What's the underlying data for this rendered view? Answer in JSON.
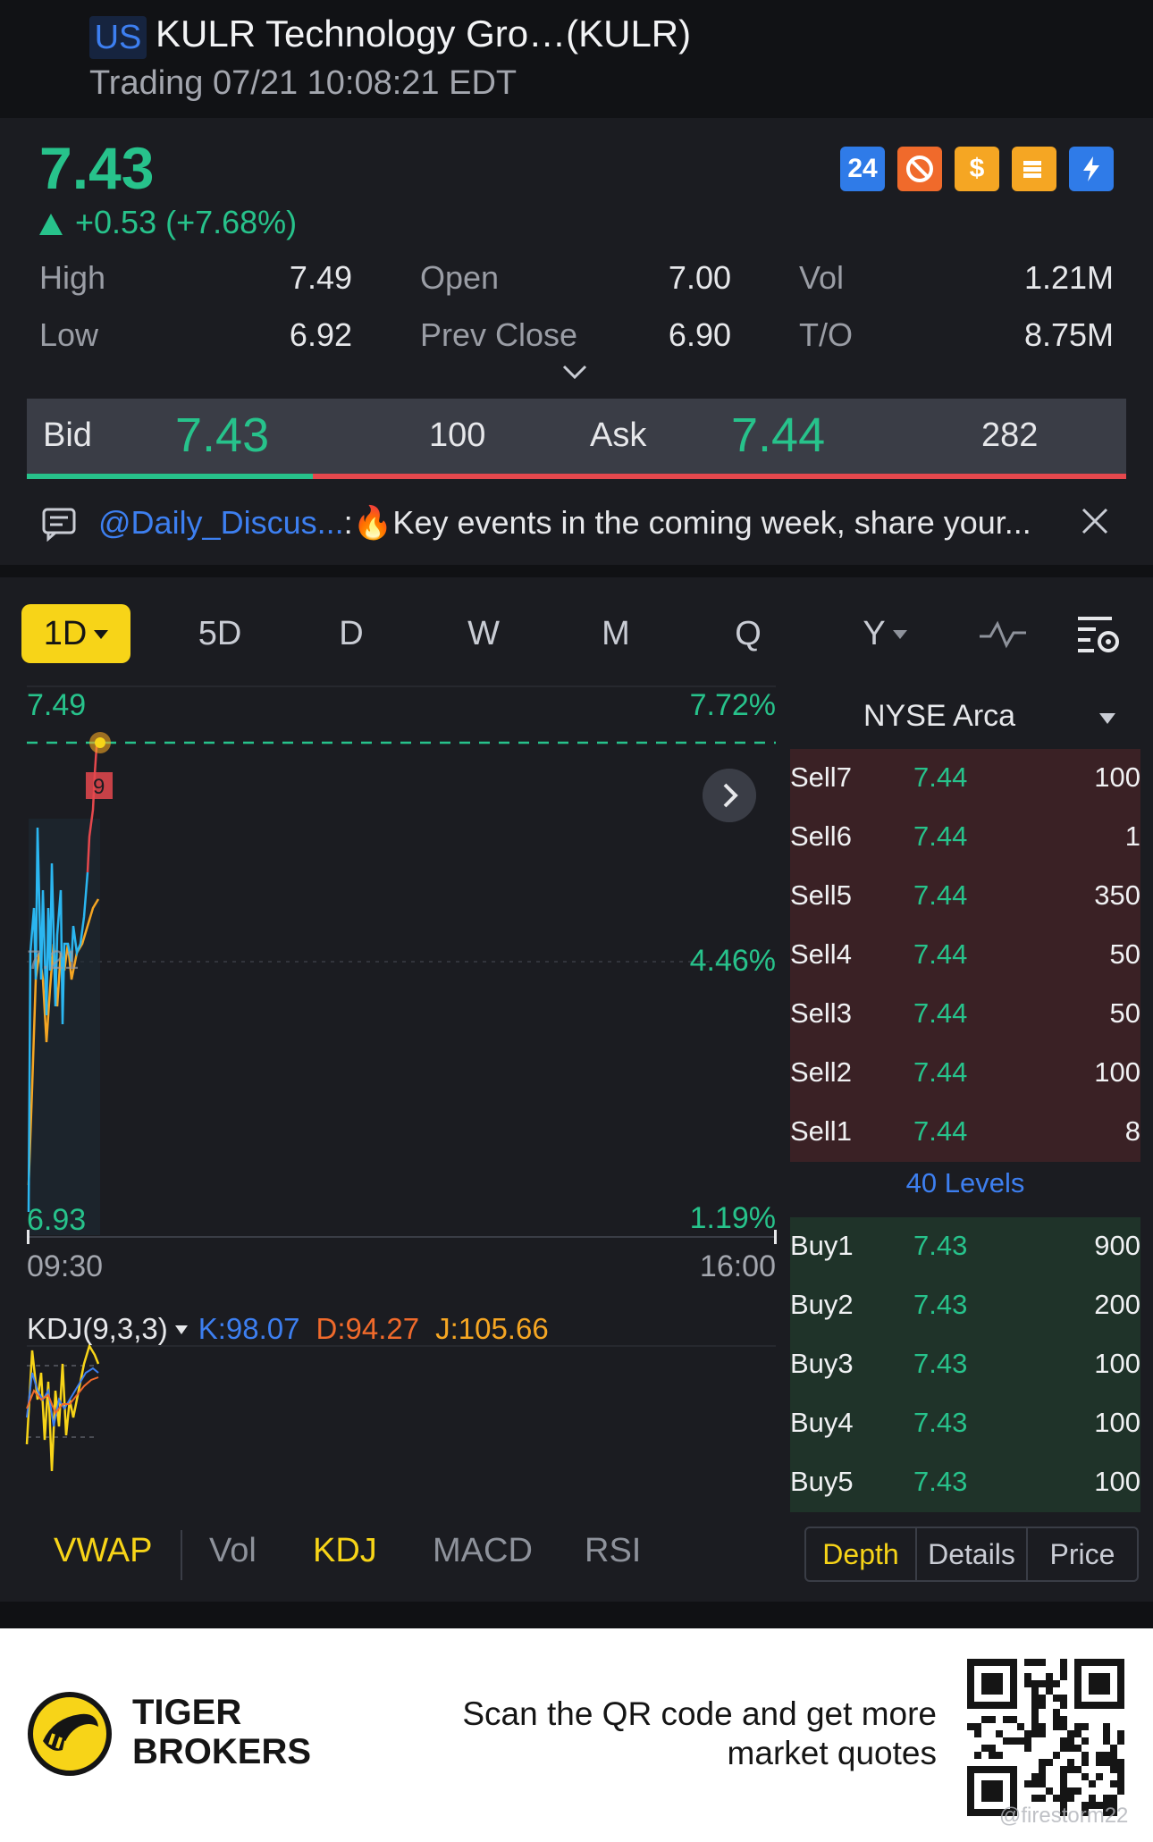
{
  "header": {
    "market_badge": "US",
    "title": "KULR Technology Gro…(KULR)",
    "status": "Trading 07/21 10:08:21 EDT"
  },
  "quote": {
    "last": "7.43",
    "change": "+0.53 (+7.68%)",
    "badges": [
      "24",
      "no-entry-icon",
      "dollar-icon",
      "stack-icon",
      "flash-icon"
    ],
    "stats": [
      {
        "label": "High",
        "value": "7.49"
      },
      {
        "label": "Open",
        "value": "7.00"
      },
      {
        "label": "Vol",
        "value": "1.21M"
      },
      {
        "label": "Low",
        "value": "6.92"
      },
      {
        "label": "Prev Close",
        "value": "6.90"
      },
      {
        "label": "T/O",
        "value": "8.75M"
      }
    ],
    "bid_label": "Bid",
    "bid": "7.43",
    "bid_size": "100",
    "ask_label": "Ask",
    "ask": "7.44",
    "ask_size": "282",
    "bid_ratio": 0.26
  },
  "discussion": {
    "user": "@Daily_Discus...",
    "text": ":🔥Key events in the coming week, share your..."
  },
  "periods": [
    "1D",
    "5D",
    "D",
    "W",
    "M",
    "Q",
    "Y"
  ],
  "active_period": "1D",
  "chart": {
    "y_high": "7.49",
    "y_low": "6.93",
    "pct_high": "7.72%",
    "pct_mid": "4.46%",
    "pct_low": "1.19%",
    "mid_price": "7.21",
    "x_start": "09:30",
    "x_end": "16:00",
    "marker": "9",
    "kdj": {
      "name": "KDJ(9,3,3)",
      "k": "K:98.07",
      "d": "D:94.27",
      "j": "J:105.66"
    }
  },
  "order_book": {
    "exchange": "NYSE Arca",
    "sell": [
      {
        "label": "Sell7",
        "price": "7.44",
        "qty": "100"
      },
      {
        "label": "Sell6",
        "price": "7.44",
        "qty": "1"
      },
      {
        "label": "Sell5",
        "price": "7.44",
        "qty": "350"
      },
      {
        "label": "Sell4",
        "price": "7.44",
        "qty": "50"
      },
      {
        "label": "Sell3",
        "price": "7.44",
        "qty": "50"
      },
      {
        "label": "Sell2",
        "price": "7.44",
        "qty": "100"
      },
      {
        "label": "Sell1",
        "price": "7.44",
        "qty": "8"
      }
    ],
    "levels": "40 Levels",
    "buy": [
      {
        "label": "Buy1",
        "price": "7.43",
        "qty": "900"
      },
      {
        "label": "Buy2",
        "price": "7.43",
        "qty": "200"
      },
      {
        "label": "Buy3",
        "price": "7.43",
        "qty": "100"
      },
      {
        "label": "Buy4",
        "price": "7.43",
        "qty": "100"
      },
      {
        "label": "Buy5",
        "price": "7.43",
        "qty": "100"
      }
    ]
  },
  "indicators": [
    "VWAP",
    "Vol",
    "KDJ",
    "MACD",
    "RSI"
  ],
  "book_tabs": [
    "Depth",
    "Details",
    "Price"
  ],
  "footer": {
    "brand_line1": "TIGER",
    "brand_line2": "BROKERS",
    "scan_line1": "Scan the QR code and get more",
    "scan_line2": "market quotes",
    "watermark": "@firestorm22"
  },
  "colors": {
    "up": "#27c28b",
    "down": "#e5484d",
    "accent": "#f7d418",
    "link": "#3d7ff0"
  }
}
